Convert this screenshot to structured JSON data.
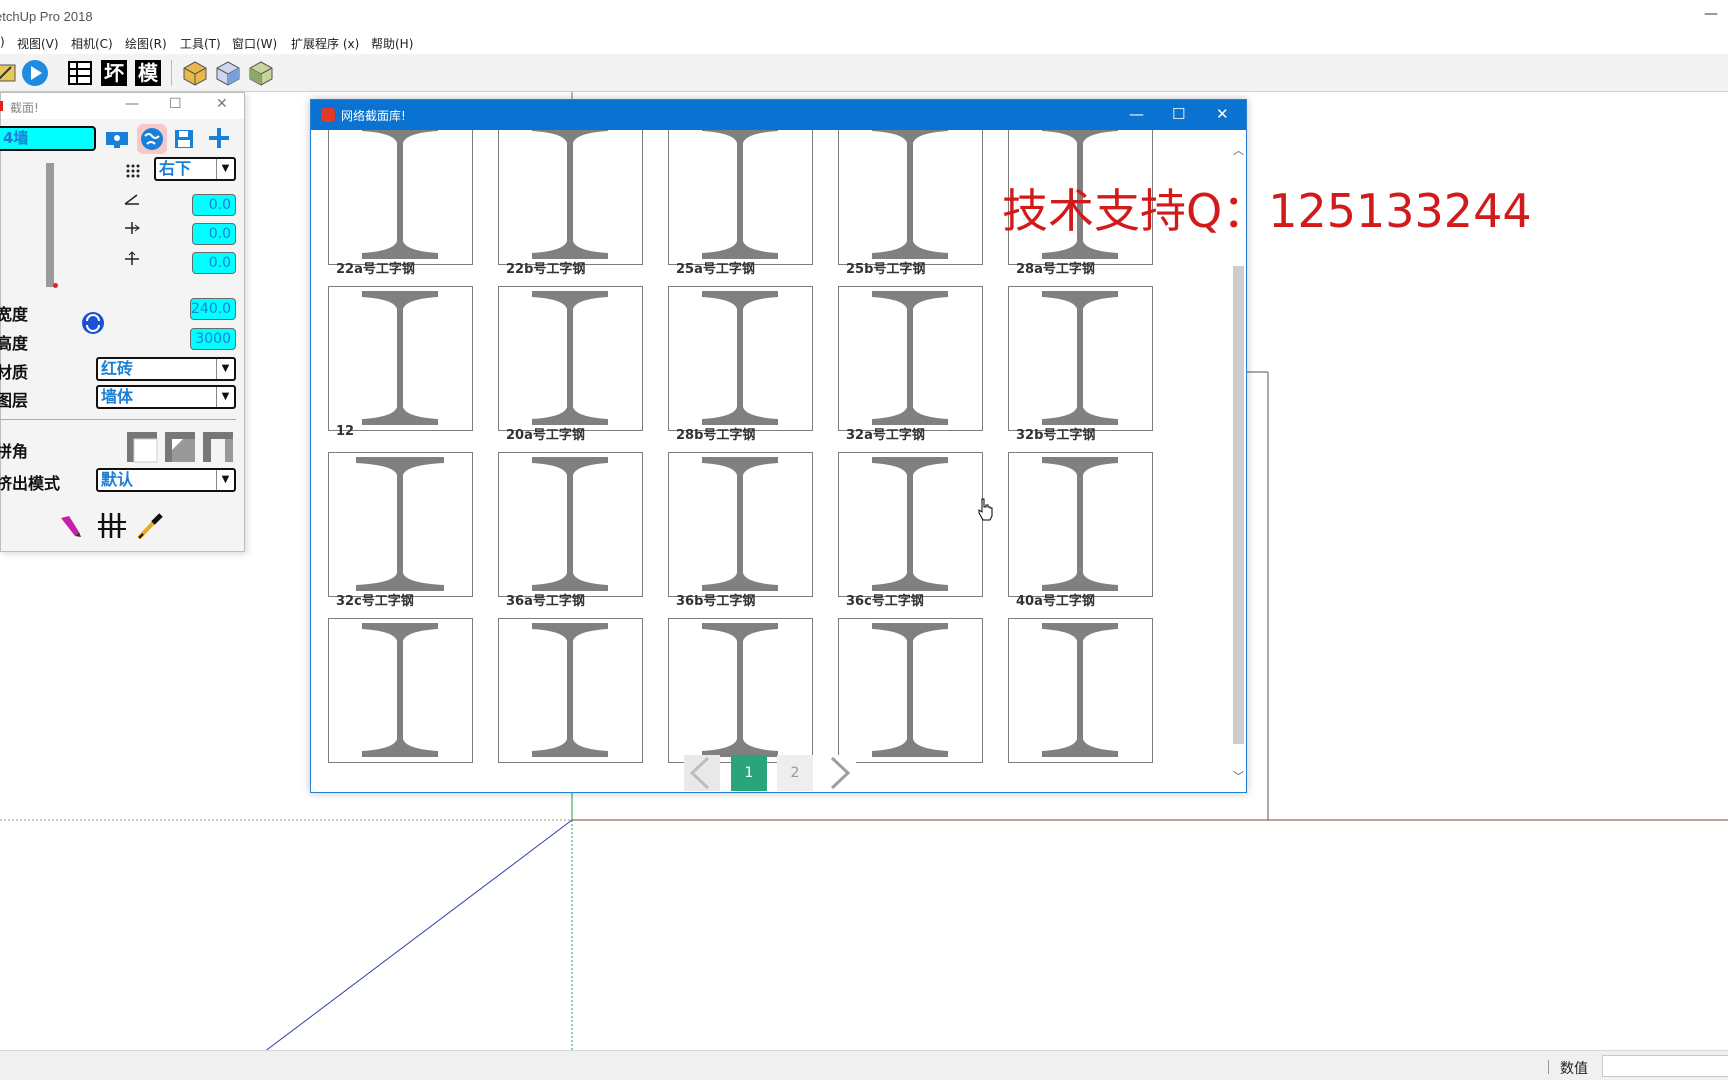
{
  "window": {
    "title": "etchUp Pro 2018",
    "minimize": "—"
  },
  "menubar": {
    "items": [
      ")",
      "视图(V)",
      "相机(C)",
      "绘图(R)",
      "工具(T)",
      "窗口(W)",
      "扩展程序 (x)",
      "帮助(H)"
    ]
  },
  "toolbar": {
    "icons": [
      "ruler-icon",
      "play-icon",
      "grid-table-icon",
      "bad-char-icon",
      "model-char-icon",
      "box-yellow-icon",
      "box-blue-icon",
      "box-green-icon"
    ],
    "char_labels": {
      "table": "⊞",
      "bad": "坏",
      "model": "模"
    }
  },
  "panel": {
    "title": "截面!",
    "name_value": "4墙",
    "anchor_value": "右下",
    "angle_value": "0.0",
    "offset_x_value": "0.0",
    "offset_y_value": "0.0",
    "width_label": "宽度",
    "width_value": "240.0",
    "height_label": "高度",
    "height_value": "3000",
    "material_label": "材质",
    "material_value": "红砖",
    "layer_label": "图层",
    "layer_value": "墙体",
    "corner_label": "拼角",
    "extrude_label": "挤出模式",
    "extrude_value": "默认"
  },
  "dialog": {
    "title": "网络截面库!",
    "rows": [
      {
        "labels": [
          "",
          "",
          "",
          "",
          ""
        ]
      },
      {
        "labels": [
          "22a号工字钢",
          "22b号工字钢",
          "25a号工字钢",
          "25b号工字钢",
          "28a号工字钢"
        ]
      },
      {
        "labels": [
          "12",
          "20a号工字钢",
          "28b号工字钢",
          "32a号工字钢",
          "32b号工字钢"
        ]
      },
      {
        "labels": [
          "32c号工字钢",
          "36a号工字钢",
          "36b号工字钢",
          "36c号工字钢",
          "40a号工字钢"
        ]
      }
    ],
    "pager": {
      "current": "1",
      "next": "2"
    }
  },
  "watermark": "技术支持Q：125133244",
  "statusbar": {
    "value_label": "数值",
    "value": ""
  },
  "colors": {
    "accent": "#0a72d0",
    "cyan": "#00ffff",
    "page_active": "#2aa57a",
    "watermark": "#d11a1a"
  }
}
